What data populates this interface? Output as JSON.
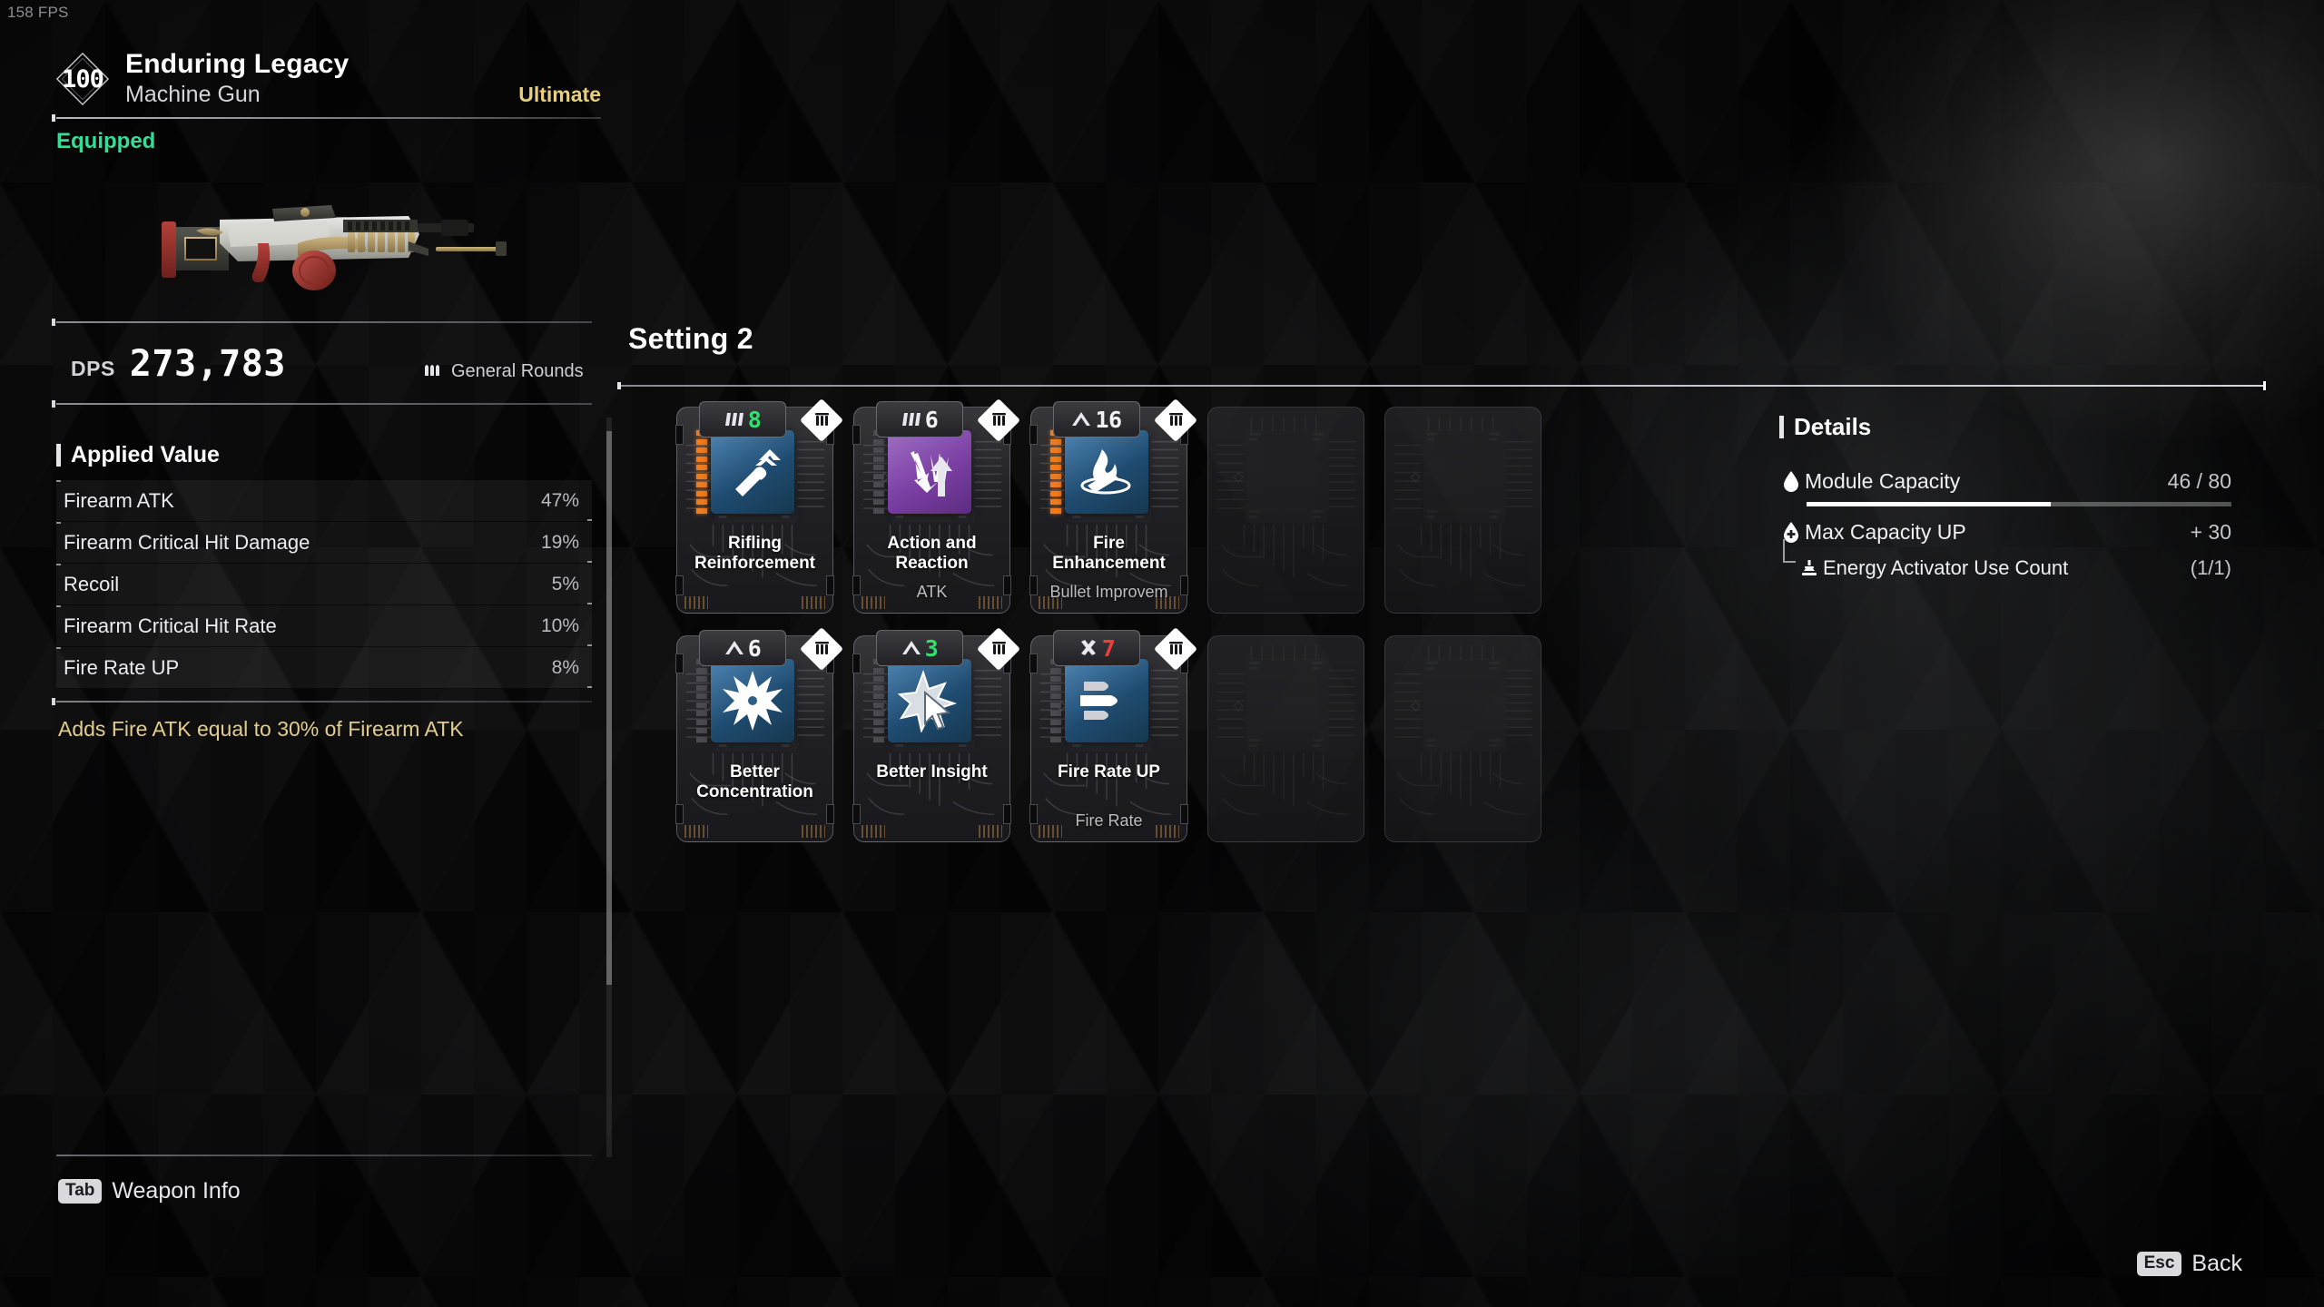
{
  "hud": {
    "fps": "158 FPS"
  },
  "weapon": {
    "level": "100",
    "name": "Enduring Legacy",
    "type": "Machine Gun",
    "tier": "Ultimate",
    "tier_color": "#e8cf7c",
    "status": "Equipped",
    "status_color": "#35dd96",
    "dps_label": "DPS",
    "dps_value": "273,783",
    "ammo_icon": "bullets-icon",
    "ammo_type": "General Rounds",
    "applied_value_title": "Applied Value",
    "stats": [
      {
        "name": "Firearm ATK",
        "value": "47%"
      },
      {
        "name": "Firearm Critical Hit Damage",
        "value": "19%"
      },
      {
        "name": "Recoil",
        "value": "5%"
      },
      {
        "name": "Firearm Critical Hit Rate",
        "value": "10%"
      },
      {
        "name": "Fire Rate UP",
        "value": "8%"
      }
    ],
    "description": "Adds Fire ATK equal to 30% of Firearm ATK"
  },
  "modules": {
    "section_title": "Setting 2",
    "slots": [
      {
        "empty": false,
        "name": "Rifling Reinforcement",
        "tag": "",
        "cost": "8",
        "cost_color": "green",
        "cost_type_icon": "bars-icon",
        "tier_icon": "socket-icon",
        "chip": "blue",
        "icon": "bullet-up-icon",
        "energy_on": 10,
        "energy_total": 10
      },
      {
        "empty": false,
        "name": "Action and Reaction",
        "tag": "ATK",
        "cost": "6",
        "cost_color": "white",
        "cost_type_icon": "bars-icon",
        "tier_icon": "socket-icon",
        "chip": "purple",
        "icon": "down-up-arrows-icon",
        "energy_on": 0,
        "energy_total": 10
      },
      {
        "empty": false,
        "name": "Fire Enhancement",
        "tag": "Bullet Improvem",
        "cost": "16",
        "cost_color": "white",
        "cost_type_icon": "chevron-icon",
        "tier_icon": "socket-icon",
        "chip": "blue",
        "icon": "fire-bullet-icon",
        "energy_on": 10,
        "energy_total": 10
      },
      {
        "empty": true
      },
      {
        "empty": true
      },
      {
        "empty": false,
        "name": "Better Concentration",
        "tag": "",
        "cost": "6",
        "cost_color": "white",
        "cost_type_icon": "chevron-icon",
        "tier_icon": "socket-icon",
        "chip": "blue",
        "icon": "starburst-icon",
        "energy_on": 0,
        "energy_total": 10
      },
      {
        "empty": false,
        "name": "Better Insight",
        "tag": "",
        "cost": "3",
        "cost_color": "green",
        "cost_type_icon": "chevron-icon",
        "tier_icon": "socket-icon",
        "chip": "blue",
        "icon": "star-cursor-icon",
        "energy_on": 0,
        "energy_total": 10
      },
      {
        "empty": false,
        "name": "Fire Rate UP",
        "tag": "Fire Rate",
        "cost": "7",
        "cost_color": "red",
        "cost_type_icon": "x-icon",
        "tier_icon": "socket-icon",
        "chip": "blue",
        "icon": "three-bullets-icon",
        "energy_on": 0,
        "energy_total": 10
      },
      {
        "empty": true
      },
      {
        "empty": true
      }
    ]
  },
  "details": {
    "title": "Details",
    "capacity": {
      "icon": "droplet-icon",
      "label": "Module Capacity",
      "value": "46 / 80",
      "percent": 57.5
    },
    "max_capacity": {
      "icon": "droplet-plus-icon",
      "label": "Max Capacity UP",
      "value": "+ 30"
    },
    "activator": {
      "icon": "activator-icon",
      "label": "Energy Activator Use Count",
      "value": "(1/1)"
    }
  },
  "footer": {
    "tab_key": "Tab",
    "tab_label": "Weapon Info",
    "esc_key": "Esc",
    "esc_label": "Back"
  }
}
